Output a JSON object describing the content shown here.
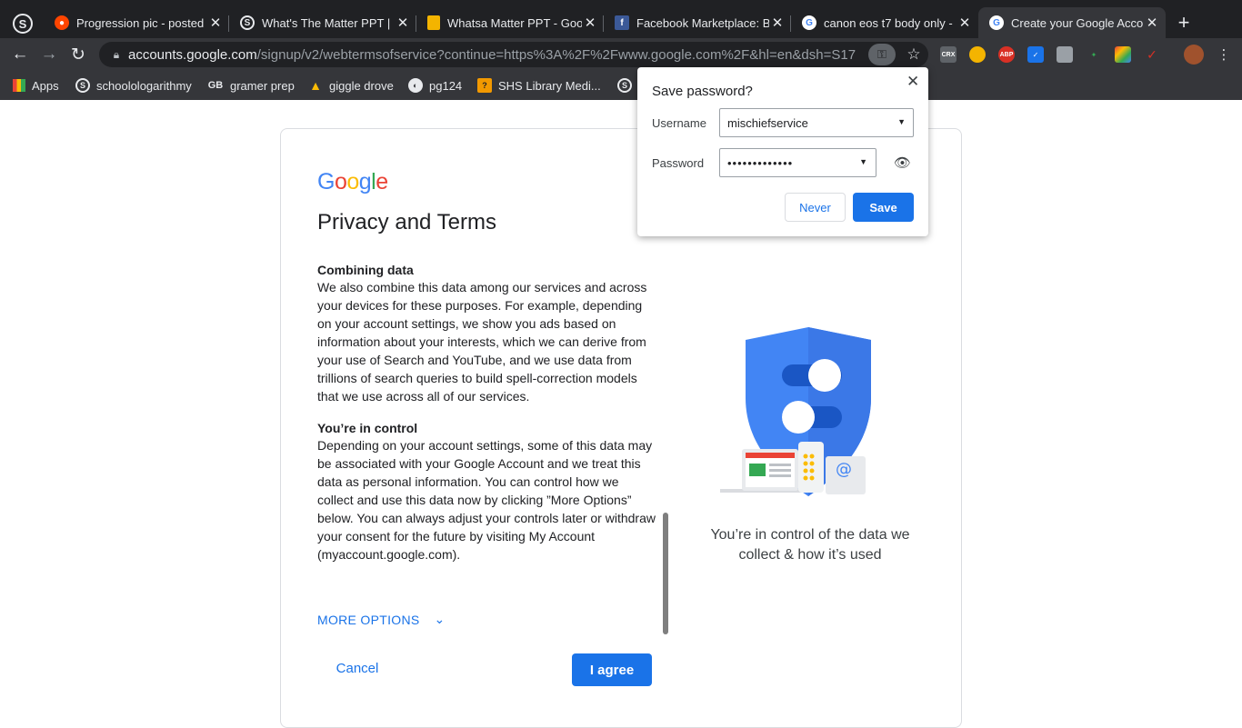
{
  "browser": {
    "pinned_tab": "S",
    "tabs": [
      {
        "title": "Progression pic - posted",
        "favicon": "reddit-icon"
      },
      {
        "title": "What's The Matter PPT |",
        "favicon": "schoology-icon"
      },
      {
        "title": "Whatsa Matter PPT - Goo",
        "favicon": "google-slides-icon"
      },
      {
        "title": "Facebook Marketplace: B",
        "favicon": "facebook-icon"
      },
      {
        "title": "canon eos t7 body only -",
        "favicon": "google-icon"
      },
      {
        "title": "Create your Google Acco",
        "favicon": "google-icon",
        "active": true
      }
    ],
    "url_main": "accounts.google.com",
    "url_rest": "/signup/v2/webtermsofservice?continue=https%3A%2F%2Fwww.google.com%2F&hl=en&dsh=S17...",
    "extensions": [
      "CRX",
      "ABP"
    ],
    "bookmarks": [
      {
        "label": "Apps",
        "icon": "apps-grid-icon"
      },
      {
        "label": "schoolologarithmy",
        "icon": "schoology-icon"
      },
      {
        "label": "gramer prep",
        "icon": "gb-icon"
      },
      {
        "label": "giggle drove",
        "icon": "google-drive-icon"
      },
      {
        "label": "pg124",
        "icon": "globe-icon"
      },
      {
        "label": "SHS Library Medi...",
        "icon": "library-icon"
      }
    ]
  },
  "page": {
    "logo": [
      "G",
      "o",
      "o",
      "g",
      "l",
      "e"
    ],
    "title": "Privacy and Terms",
    "sections": [
      {
        "heading": "Combining data",
        "body": "We also combine this data among our services and across your devices for these purposes. For example, depending on your account settings, we show you ads based on information about your interests, which we can derive from your use of Search and YouTube, and we use data from trillions of search queries to build spell-correction models that we use across all of our services."
      },
      {
        "heading": "You’re in control",
        "body": "Depending on your account settings, some of this data may be associated with your Google Account and we treat this data as personal information. You can control how we collect and use this data now by clicking ”More Options” below. You can always adjust your controls later or withdraw your consent for the future by visiting My Account (myaccount.google.com)."
      }
    ],
    "more_options": "MORE OPTIONS",
    "cancel": "Cancel",
    "agree": "I agree",
    "caption": "You’re in control of the data we collect & how it’s used"
  },
  "save_password": {
    "title": "Save password?",
    "username_label": "Username",
    "username_value": "mischiefservice",
    "password_label": "Password",
    "password_value": "•••••••••••••",
    "never": "Never",
    "save": "Save"
  },
  "colors": {
    "accent": "#1a73e8",
    "chrome_dark": "#202124",
    "chrome_toolbar": "#35363a"
  }
}
